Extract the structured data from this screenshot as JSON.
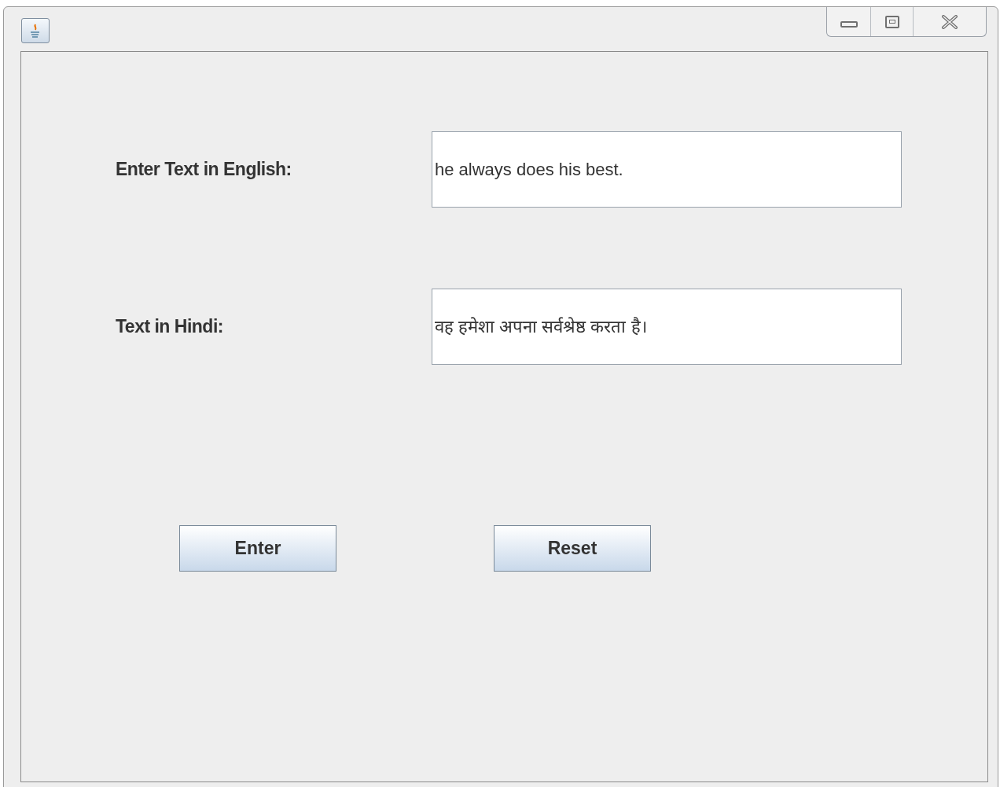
{
  "form": {
    "rows": [
      {
        "label": "Enter Text in English:",
        "value": "he always does his best."
      },
      {
        "label": "Text in Hindi:",
        "value": "वह हमेशा अपना सर्वश्रेष्ठ करता है।"
      }
    ]
  },
  "buttons": [
    "Enter",
    "Reset"
  ]
}
